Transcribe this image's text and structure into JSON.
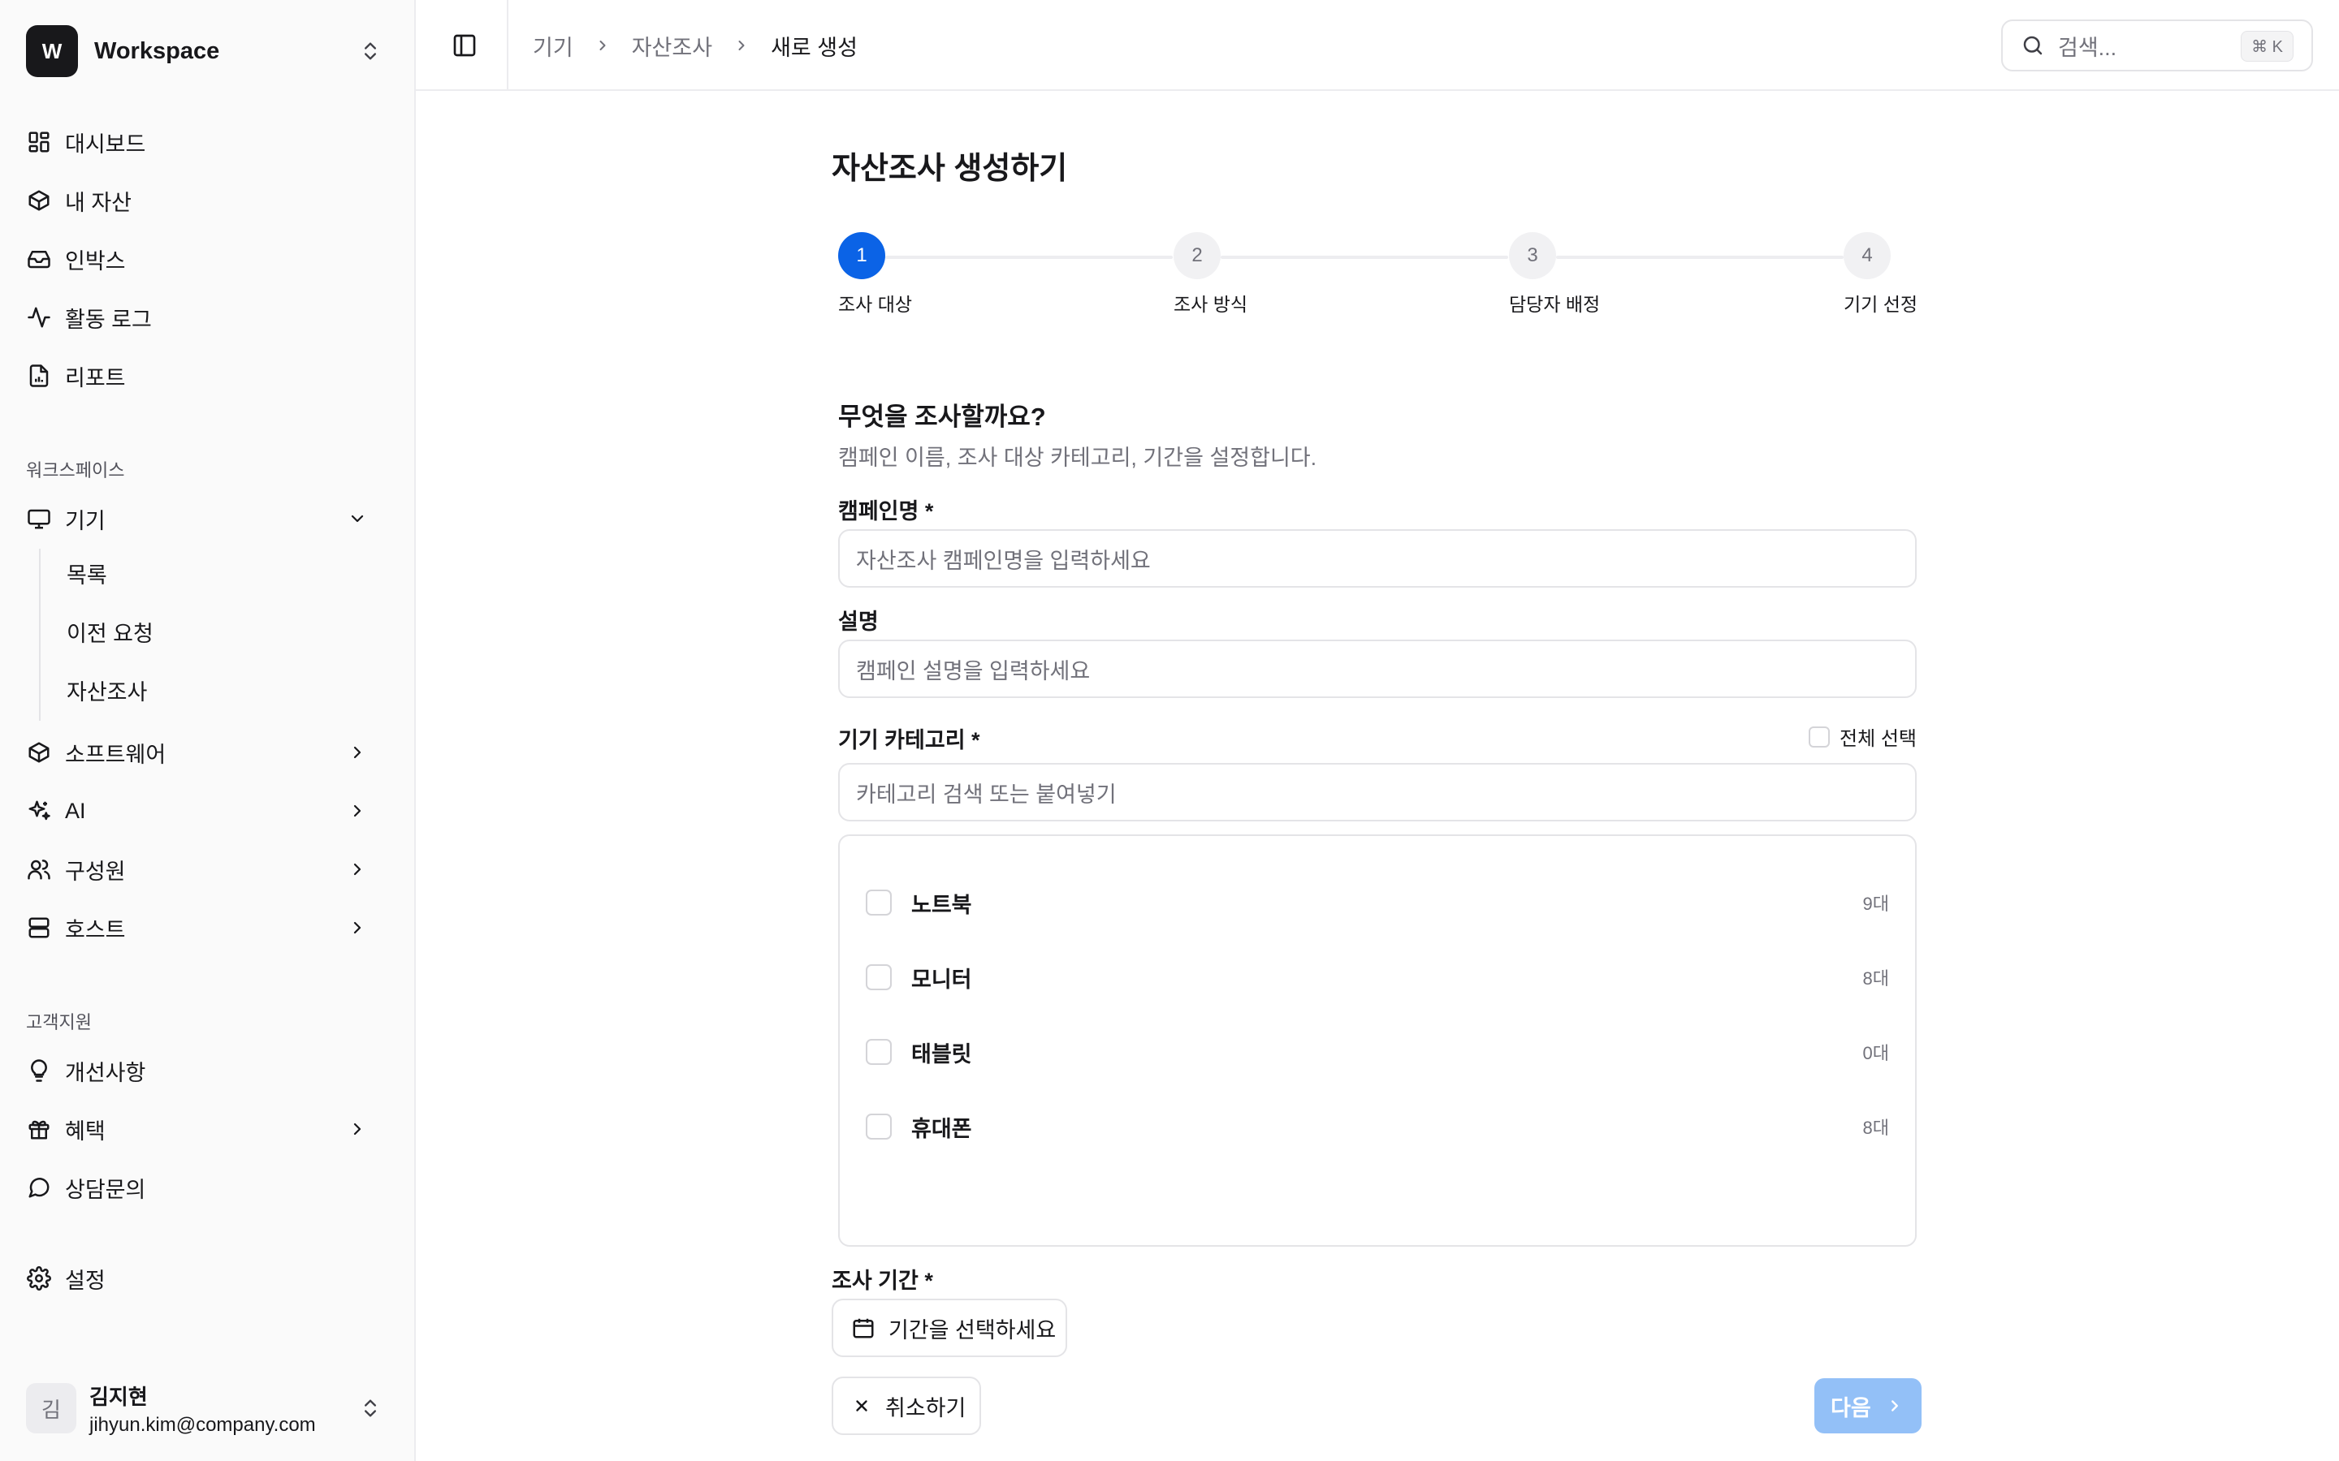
{
  "workspace": {
    "logo_letter": "W",
    "name": "Workspace"
  },
  "sidebar": {
    "main_items": [
      {
        "label": "대시보드",
        "icon": "dashboard-icon"
      },
      {
        "label": "내 자산",
        "icon": "box-icon"
      },
      {
        "label": "인박스",
        "icon": "inbox-icon"
      },
      {
        "label": "활동 로그",
        "icon": "activity-icon"
      },
      {
        "label": "리포트",
        "icon": "report-icon"
      }
    ],
    "workspace_section": "워크스페이스",
    "devices": {
      "label": "기기",
      "sub_items": [
        "목록",
        "이전 요청",
        "자산조사"
      ]
    },
    "workspace_items": [
      {
        "label": "소프트웨어",
        "icon": "box-icon"
      },
      {
        "label": "AI",
        "icon": "sparkles-icon"
      },
      {
        "label": "구성원",
        "icon": "users-icon"
      },
      {
        "label": "호스트",
        "icon": "server-icon"
      }
    ],
    "support_section": "고객지원",
    "support_items": [
      {
        "label": "개선사항",
        "icon": "lightbulb-icon"
      },
      {
        "label": "혜택",
        "icon": "gift-icon"
      },
      {
        "label": "상담문의",
        "icon": "chat-icon"
      }
    ],
    "settings_label": "설정",
    "user": {
      "avatar_initial": "김",
      "name": "김지현",
      "email": "jihyun.kim@company.com"
    }
  },
  "header": {
    "breadcrumbs": [
      "기기",
      "자산조사",
      "새로 생성"
    ],
    "search_placeholder": "검색...",
    "search_shortcut": "⌘ K"
  },
  "main": {
    "page_title": "자산조사 생성하기",
    "steps": [
      {
        "number": "1",
        "label": "조사 대상",
        "active": true
      },
      {
        "number": "2",
        "label": "조사 방식",
        "active": false
      },
      {
        "number": "3",
        "label": "담당자 배정",
        "active": false
      },
      {
        "number": "4",
        "label": "기기 선정",
        "active": false
      }
    ],
    "section_title": "무엇을 조사할까요?",
    "section_desc": "캠페인 이름, 조사 대상 카테고리, 기간을 설정합니다.",
    "campaign_label": "캠페인명 *",
    "campaign_placeholder": "자산조사 캠페인명을 입력하세요",
    "desc_label": "설명",
    "desc_placeholder": "캠페인 설명을 입력하세요",
    "category_label": "기기 카테고리 *",
    "select_all_label": "전체 선택",
    "category_search_placeholder": "카테고리 검색 또는 붙여넣기",
    "categories": [
      {
        "name": "노트북",
        "count": "9대"
      },
      {
        "name": "모니터",
        "count": "8대"
      },
      {
        "name": "태블릿",
        "count": "0대"
      },
      {
        "name": "휴대폰",
        "count": "8대"
      }
    ],
    "period_label": "조사 기간 *",
    "period_button": "기간을 선택하세요",
    "cancel_button": "취소하기",
    "next_button": "다음"
  },
  "colors": {
    "accent": "#0b63e6",
    "next_disabled": "#93c0f7",
    "border": "#e4e4e7",
    "muted_text": "#71717a"
  }
}
